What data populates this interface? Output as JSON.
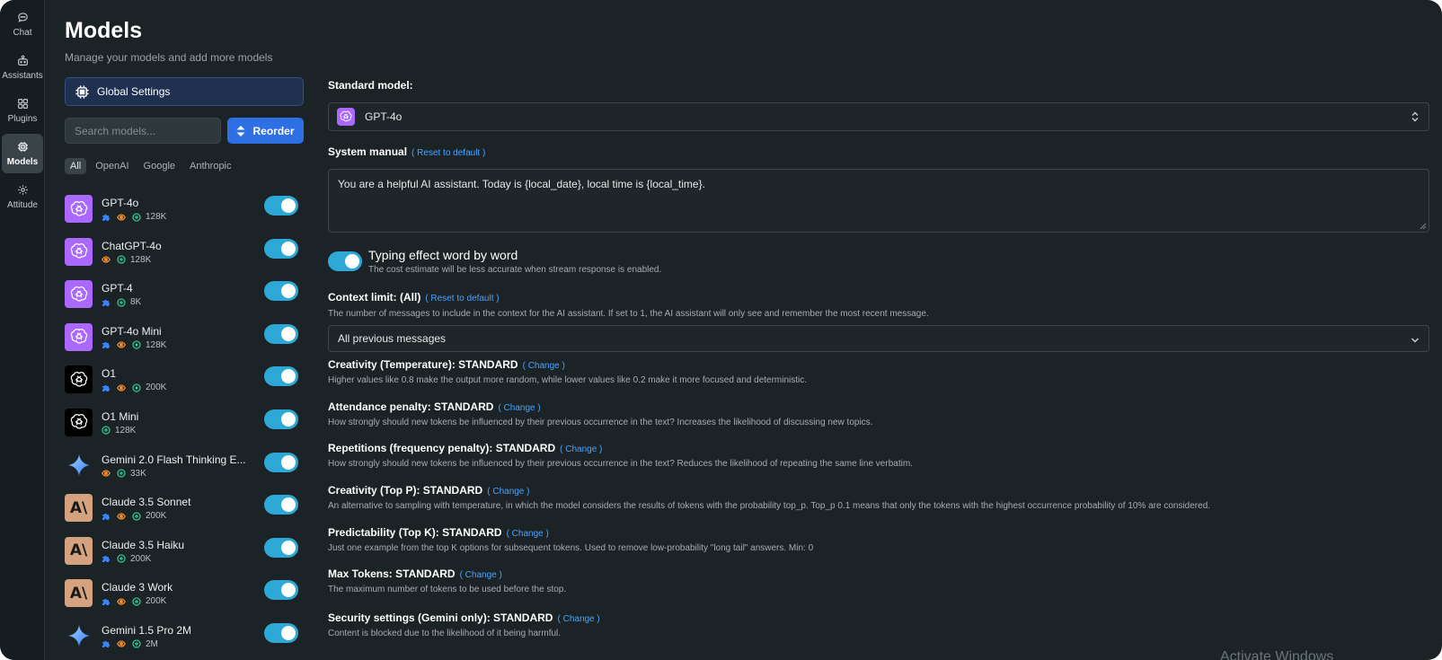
{
  "rail": {
    "items": [
      {
        "label": "Chat",
        "icon": "chat-icon"
      },
      {
        "label": "Assistants",
        "icon": "assistants-icon"
      },
      {
        "label": "Plugins",
        "icon": "plugins-icon"
      },
      {
        "label": "Models",
        "icon": "chip-icon",
        "active": true
      },
      {
        "label": "Attitude",
        "icon": "gear-icon"
      }
    ]
  },
  "header": {
    "title": "Models",
    "subtitle": "Manage your models and add more models"
  },
  "global_settings_label": "Global Settings",
  "search": {
    "placeholder": "Search models..."
  },
  "reorder_label": "Reorder",
  "filters": [
    {
      "label": "All",
      "active": true
    },
    {
      "label": "OpenAI"
    },
    {
      "label": "Google"
    },
    {
      "label": "Anthropic"
    }
  ],
  "models": [
    {
      "name": "GPT-4o",
      "icon": "openai-icon",
      "caps": [
        "plugins",
        "vision"
      ],
      "context": "128K",
      "enabled": true
    },
    {
      "name": "ChatGPT-4o",
      "icon": "openai-icon",
      "caps": [
        "vision"
      ],
      "context": "128K",
      "enabled": true
    },
    {
      "name": "GPT-4",
      "icon": "openai-icon",
      "caps": [
        "plugins"
      ],
      "context": "8K",
      "enabled": true
    },
    {
      "name": "GPT-4o Mini",
      "icon": "openai-icon",
      "caps": [
        "plugins",
        "vision"
      ],
      "context": "128K",
      "enabled": true
    },
    {
      "name": "O1",
      "icon": "openai-icon",
      "caps": [
        "plugins",
        "vision"
      ],
      "context": "200K",
      "enabled": true
    },
    {
      "name": "O1 Mini",
      "icon": "openai-icon",
      "caps": [],
      "context": "128K",
      "enabled": true
    },
    {
      "name": "Gemini 2.0 Flash Thinking E...",
      "icon": "gemini-icon",
      "caps": [
        "vision"
      ],
      "context": "33K",
      "enabled": true
    },
    {
      "name": "Claude 3.5 Sonnet",
      "icon": "anthropic-icon",
      "caps": [
        "plugins",
        "vision"
      ],
      "context": "200K",
      "enabled": true
    },
    {
      "name": "Claude 3.5 Haiku",
      "icon": "anthropic-icon",
      "caps": [
        "plugins"
      ],
      "context": "200K",
      "enabled": true
    },
    {
      "name": "Claude 3 Work",
      "icon": "anthropic-icon",
      "caps": [
        "plugins",
        "vision"
      ],
      "context": "200K",
      "enabled": true
    },
    {
      "name": "Gemini 1.5 Pro 2M",
      "icon": "gemini-icon",
      "caps": [
        "plugins",
        "vision"
      ],
      "context": "2M",
      "enabled": true
    }
  ],
  "settings": {
    "standard_model": {
      "label": "Standard model:",
      "value": "GPT-4o"
    },
    "system_manual": {
      "label": "System manual",
      "reset": "( Reset to default )",
      "value": "You are a helpful AI assistant. Today is {local_date}, local time is {local_time}."
    },
    "typing": {
      "label": "Typing effect word by word",
      "desc": "The cost estimate will be less accurate when stream response is enabled.",
      "enabled": true
    },
    "context_limit": {
      "label": "Context limit: (All)",
      "reset": "( Reset to default )",
      "desc": "The number of messages to include in the context for the AI assistant. If set to 1, the AI assistant will only see and remember the most recent message.",
      "value": "All previous messages"
    },
    "params": [
      {
        "label": "Creativity (Temperature): STANDARD",
        "link": "( Change )",
        "desc": "Higher values like 0.8 make the output more random, while lower values like 0.2 make it more focused and deterministic."
      },
      {
        "label": "Attendance penalty: STANDARD",
        "link": "( Change )",
        "desc": "How strongly should new tokens be influenced by their previous occurrence in the text? Increases the likelihood of discussing new topics."
      },
      {
        "label": "Repetitions (frequency penalty): STANDARD",
        "link": "( Change )",
        "desc": "How strongly should new tokens be influenced by their previous occurrence in the text? Reduces the likelihood of repeating the same line verbatim."
      },
      {
        "label": "Creativity (Top P): STANDARD",
        "link": "( Change )",
        "desc": "An alternative to sampling with temperature, in which the model considers the results of tokens with the probability top_p. Top_p 0.1 means that only the tokens with the highest occurrence probability of 10% are considered."
      },
      {
        "label": "Predictability (Top K): STANDARD",
        "link": "( Change )",
        "desc": "Just one example from the top K options for subsequent tokens. Used to remove low-probability \"long tail\" answers. Min: 0"
      },
      {
        "label": "Max Tokens: STANDARD",
        "link": "( Change )",
        "desc": "The maximum number of tokens to be used before the stop."
      },
      {
        "label": "Security settings (Gemini only): STANDARD",
        "link": "( Change )",
        "desc": "Content is blocked due to the likelihood of it being harmful."
      }
    ]
  },
  "watermark": "Activate Windows",
  "colors": {
    "accent": "#2f6fe4",
    "toggle": "#2ea8d6",
    "link": "#4aa3ff",
    "bg": "#1b2326"
  }
}
